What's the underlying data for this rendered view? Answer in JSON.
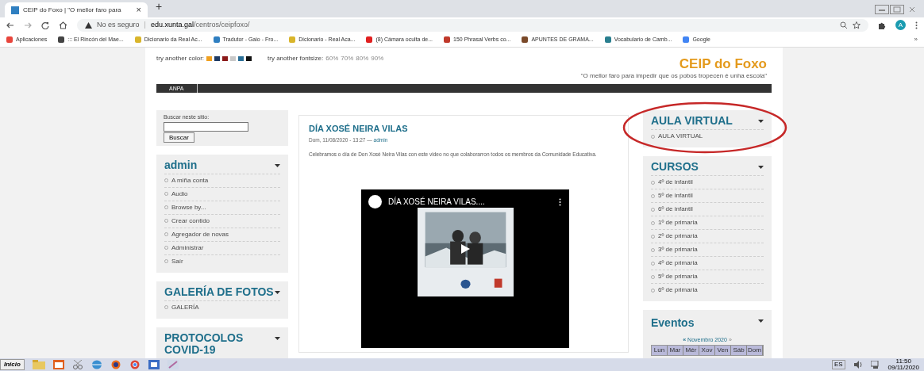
{
  "browser": {
    "tab": {
      "title": "CEIP do Foxo | \"O mellor faro para",
      "close": "×"
    },
    "new_tab": "+",
    "address": {
      "security": "No es seguro",
      "separator": "|",
      "domain": "edu.xunta.gal",
      "path": "/centros/ceipfoxo/"
    },
    "profile": "A",
    "bookmarks": [
      {
        "label": "Aplicaciones",
        "color": "#e8453c"
      },
      {
        "label": "::: El Rincón del Mae...",
        "color": "#444444"
      },
      {
        "label": "Dicionario da Real Ac...",
        "color": "#d9b52b"
      },
      {
        "label": "Tradutor - Gaio - Fro...",
        "color": "#2f7fc1"
      },
      {
        "label": "Dicionario - Real Aca...",
        "color": "#d9b52b"
      },
      {
        "label": "(8) Cámara oculta de...",
        "color": "#e02020"
      },
      {
        "label": "150 Phrasal Verbs co...",
        "color": "#c0392b"
      },
      {
        "label": "APUNTES DE GRAMA...",
        "color": "#7a4a2a"
      },
      {
        "label": "Vocabulario de Camb...",
        "color": "#2a7f8f"
      },
      {
        "label": "Google",
        "color": "#4285f4"
      }
    ],
    "bookmarks_more": "»"
  },
  "page": {
    "color_options": {
      "label": "try another color:",
      "swatches": [
        {
          "color": "#f0a020"
        },
        {
          "color": "#1f3b63"
        },
        {
          "color": "#8b1a1a"
        },
        {
          "color": "#c8c8c8"
        },
        {
          "color": "#2a6f97"
        },
        {
          "color": "#111111"
        }
      ]
    },
    "fontsize_options": {
      "label": "try another fontsize:",
      "sizes": [
        "60%",
        "70%",
        "80%",
        "90%"
      ]
    },
    "site_title": "CEIP do Foxo",
    "slogan": "\"O mellor faro para impedir que os pobos tropecen é unha escola\"",
    "nav": [
      {
        "label": "ANPA"
      }
    ],
    "search": {
      "label": "Buscar neste sitio:",
      "button": "Buscar"
    },
    "left_blocks": [
      {
        "title": "admin",
        "items": [
          "A miña conta",
          "Audio",
          "Browse by...",
          "Crear contido",
          "Agregador de novas",
          "Administrar",
          "Saír"
        ]
      },
      {
        "title": "GALERÍA DE FOTOS",
        "items": [
          "GALERÍA"
        ]
      },
      {
        "title": "PROTOCOLOS COVID-19"
      }
    ],
    "article": {
      "title": "DÍA XOSÉ NEIRA VILAS",
      "date": "Dom, 11/08/2020 - 13:27 —",
      "author": "admin",
      "body": "Celebramos o día de Don Xosé Neira Vilas con este video no que colaborarron todos os membros da Comunidade Educativa.",
      "video": {
        "title": "DÍA XOSÉ NEIRA VILAS...."
      }
    },
    "right_blocks": [
      {
        "title": "AULA VIRTUAL",
        "highlighted": true,
        "items": [
          "AULA VIRTUAL"
        ]
      },
      {
        "title": "CURSOS",
        "highlighted": false,
        "items": [
          "4º de infantil",
          "5º de infantil",
          "6º de infantil",
          "1º de primaria",
          "2º de primaria",
          "3º de primaria",
          "4º de primaria",
          "5º de primaria",
          "6º de primaria"
        ]
      }
    ],
    "events": {
      "title": "Eventos",
      "prev": "«",
      "month": "Novembro 2020",
      "next": "»",
      "weekdays": [
        "Lun",
        "Mar",
        "Mér",
        "Xov",
        "Ven",
        "Sáb",
        "Dom"
      ]
    }
  },
  "taskbar": {
    "start": "Inicio",
    "language": "ES",
    "time": "11:50",
    "date": "09/11/2020"
  }
}
